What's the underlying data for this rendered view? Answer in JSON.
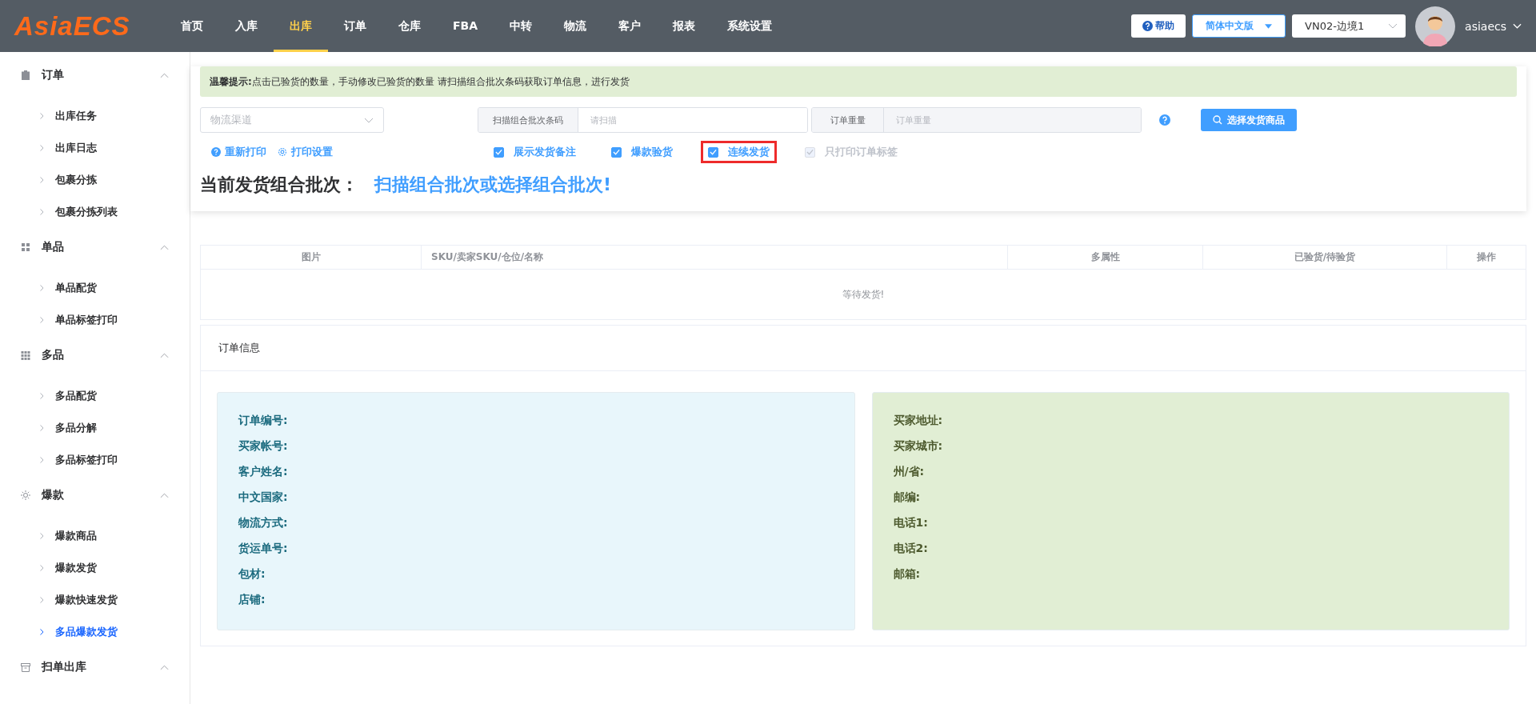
{
  "header": {
    "logo": "AsiaECS",
    "nav": [
      {
        "label": "首页",
        "selected": false
      },
      {
        "label": "入库",
        "selected": false
      },
      {
        "label": "出库",
        "selected": true
      },
      {
        "label": "订单",
        "selected": false
      },
      {
        "label": "仓库",
        "selected": false
      },
      {
        "label": "FBA",
        "selected": false
      },
      {
        "label": "中转",
        "selected": false
      },
      {
        "label": "物流",
        "selected": false
      },
      {
        "label": "客户",
        "selected": false
      },
      {
        "label": "报表",
        "selected": false
      },
      {
        "label": "系统设置",
        "selected": false
      }
    ],
    "help": "帮助",
    "language": "简体中文版",
    "warehouse": "VN02-边境1",
    "user": "asiaecs"
  },
  "sidebar": [
    {
      "label": "订单",
      "expanded": true,
      "children": [
        {
          "label": "出库任务",
          "selected": false
        },
        {
          "label": "出库日志",
          "selected": false
        },
        {
          "label": "包裹分拣",
          "selected": false
        },
        {
          "label": "包裹分拣列表",
          "selected": false
        }
      ]
    },
    {
      "label": "单品",
      "expanded": true,
      "children": [
        {
          "label": "单品配货",
          "selected": false
        },
        {
          "label": "单品标签打印",
          "selected": false
        }
      ]
    },
    {
      "label": "多品",
      "expanded": true,
      "children": [
        {
          "label": "多品配货",
          "selected": false
        },
        {
          "label": "多品分解",
          "selected": false
        },
        {
          "label": "多品标签打印",
          "selected": false
        }
      ]
    },
    {
      "label": "爆款",
      "expanded": true,
      "children": [
        {
          "label": "爆款商品",
          "selected": false
        },
        {
          "label": "爆款发货",
          "selected": false
        },
        {
          "label": "爆款快速发货",
          "selected": false
        },
        {
          "label": "多品爆款发货",
          "selected": true
        }
      ]
    },
    {
      "label": "扫单出库",
      "expanded": true
    }
  ],
  "tip": "**温馨提示:**点击已验货的数量，手动修改已验货的数量 请扫描组合批次条码获取订单信息，进行发货",
  "logistics_select": {
    "placeholder": "物流渠道"
  },
  "scan_field": {
    "label": "扫描组合批次条码",
    "placeholder": "请扫描"
  },
  "weight_field": {
    "label": "订单重量",
    "placeholder": "订单重量"
  },
  "select_button": "选择发货商品",
  "links": [
    "重新打印",
    "打印设置"
  ],
  "options": [
    {
      "label": "展示发货备注",
      "checked": true,
      "disabled": false,
      "highlighted": false
    },
    {
      "label": "爆款验货",
      "checked": true,
      "disabled": false,
      "highlighted": false
    },
    {
      "label": "连续发货",
      "checked": true,
      "disabled": false,
      "highlighted": true
    },
    {
      "label": "只打印订单标签",
      "checked": true,
      "disabled": true,
      "highlighted": false
    }
  ],
  "batch": {
    "label": "当前发货组合批次：",
    "value": "扫描组合批次或选择组合批次!"
  },
  "table": {
    "columns": [
      "图片",
      "SKU/卖家SKU/仓位/名称",
      "多属性",
      "已验货/待验货",
      "操作"
    ],
    "empty": "等待发货!"
  },
  "order_info": {
    "title": "订单信息",
    "left": [
      "订单编号:",
      "买家帐号:",
      "客户姓名:",
      "中文国家:",
      "物流方式:",
      "货运单号:",
      "包材:",
      "店铺:"
    ],
    "right": [
      "买家地址:",
      "买家城市:",
      "州/省:",
      "邮编:",
      "电话1:",
      "电话2:",
      "邮箱:"
    ]
  }
}
